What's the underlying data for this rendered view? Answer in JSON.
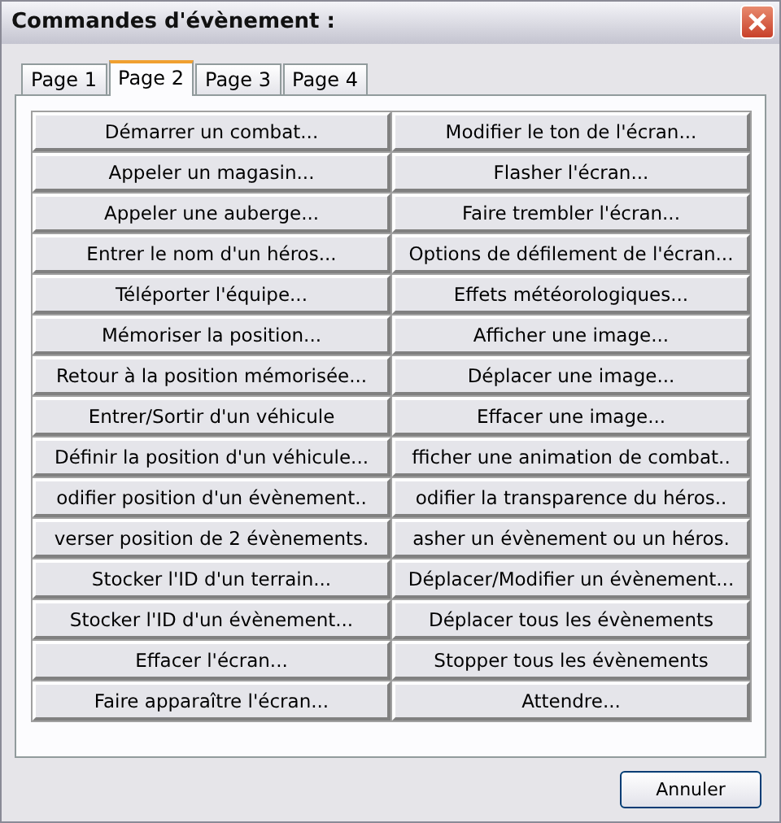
{
  "window": {
    "title": "Commandes d'évènement :"
  },
  "tabs": [
    {
      "label": "Page 1",
      "selected": false
    },
    {
      "label": "Page 2",
      "selected": true
    },
    {
      "label": "Page 3",
      "selected": false
    },
    {
      "label": "Page 4",
      "selected": false
    }
  ],
  "commands": [
    [
      "Démarrer un combat...",
      "Modifier le ton de l'écran..."
    ],
    [
      "Appeler un magasin...",
      "Flasher l'écran..."
    ],
    [
      "Appeler une auberge...",
      "Faire trembler l'écran..."
    ],
    [
      "Entrer le nom d'un héros...",
      "Options de défilement de l'écran..."
    ],
    [
      "Téléporter l'équipe...",
      "Effets météorologiques..."
    ],
    [
      "Mémoriser la position...",
      "Afficher une image..."
    ],
    [
      "Retour à la position mémorisée...",
      "Déplacer une image..."
    ],
    [
      "Entrer/Sortir d'un véhicule",
      "Effacer une image..."
    ],
    [
      "Définir la position d'un véhicule...",
      "fficher une animation de combat.."
    ],
    [
      "odifier position d'un évènement..",
      "odifier la transparence du héros.."
    ],
    [
      "verser position de 2 évènements.",
      "asher un évènement ou un héros."
    ],
    [
      "Stocker l'ID d'un terrain...",
      "Déplacer/Modifier un évènement..."
    ],
    [
      "Stocker l'ID d'un évènement...",
      "Déplacer tous les évènements"
    ],
    [
      "Effacer l'écran...",
      "Stopper tous les évènements"
    ],
    [
      "Faire apparaître l'écran...",
      "Attendre..."
    ]
  ],
  "buttons": [
    "Annuler"
  ]
}
